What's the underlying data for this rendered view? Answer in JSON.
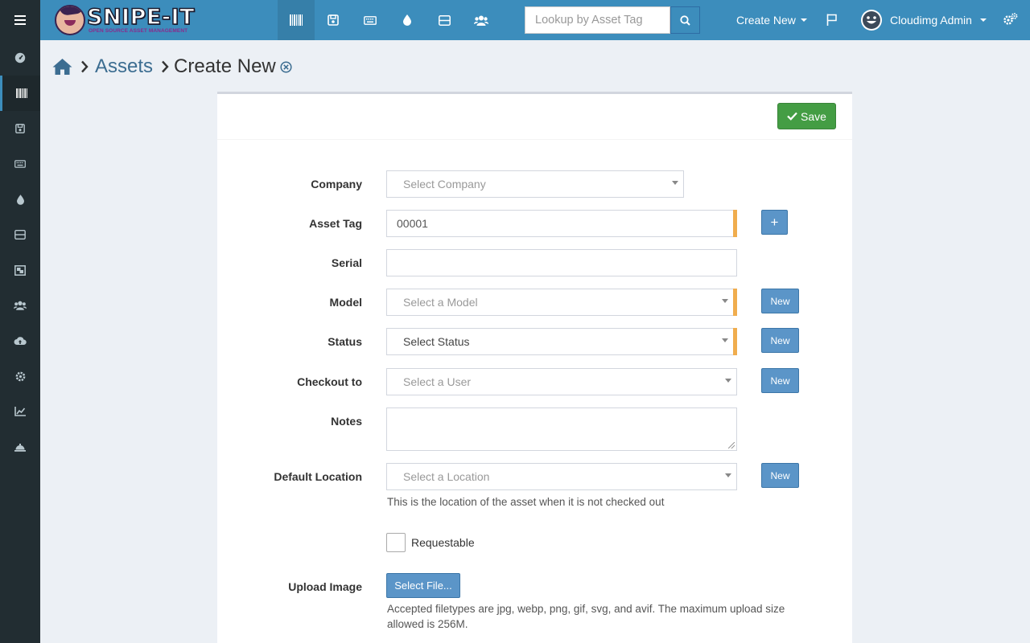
{
  "nav": {
    "brand": "SNIPE-IT",
    "brand_sub": "OPEN SOURCE ASSET MANAGEMENT",
    "icons": [
      "barcode-icon",
      "hdd-icon",
      "keyboard-icon",
      "tint-icon",
      "server-icon",
      "users-icon"
    ],
    "search_placeholder": "Lookup by Asset Tag",
    "create_new": "Create New",
    "user_name": "Cloudimg Admin"
  },
  "sidebar": {
    "items": [
      {
        "name": "dashboard",
        "icon": "tachometer-icon"
      },
      {
        "name": "assets",
        "icon": "barcode-icon",
        "active": true
      },
      {
        "name": "licenses",
        "icon": "save-icon"
      },
      {
        "name": "accessories",
        "icon": "keyboard-icon"
      },
      {
        "name": "consumables",
        "icon": "tint-icon"
      },
      {
        "name": "components",
        "icon": "hdd-icon"
      },
      {
        "name": "predefined-kits",
        "icon": "object-group-icon"
      },
      {
        "name": "people",
        "icon": "users-icon"
      },
      {
        "name": "import",
        "icon": "cloud-upload-icon"
      },
      {
        "name": "settings",
        "icon": "cog-icon"
      },
      {
        "name": "reports",
        "icon": "chart-icon"
      },
      {
        "name": "requestable",
        "icon": "bell-icon"
      }
    ]
  },
  "breadcrumb": {
    "assets": "Assets",
    "current": "Create New"
  },
  "form": {
    "save_label": "Save",
    "company_label": "Company",
    "company_placeholder": "Select Company",
    "asset_tag_label": "Asset Tag",
    "asset_tag_value": "00001",
    "add_tag_label": "+",
    "serial_label": "Serial",
    "serial_value": "",
    "model_label": "Model",
    "model_placeholder": "Select a Model",
    "status_label": "Status",
    "status_placeholder": "Select Status",
    "checkout_label": "Checkout to",
    "checkout_placeholder": "Select a User",
    "notes_label": "Notes",
    "location_label": "Default Location",
    "location_placeholder": "Select a Location",
    "location_help": "This is the location of the asset when it is not checked out",
    "requestable_label": "Requestable",
    "upload_label": "Upload Image",
    "select_file_label": "Select File...",
    "upload_help": "Accepted filetypes are jpg, webp, png, gif, svg, and avif. The maximum upload size allowed is 256M.",
    "new_label": "New"
  },
  "colors": {
    "navbar": "#3c8dbc",
    "sidebar": "#222d32",
    "save": "#449d44",
    "required": "#f0ad4e",
    "new_button": "#5b95c8"
  }
}
